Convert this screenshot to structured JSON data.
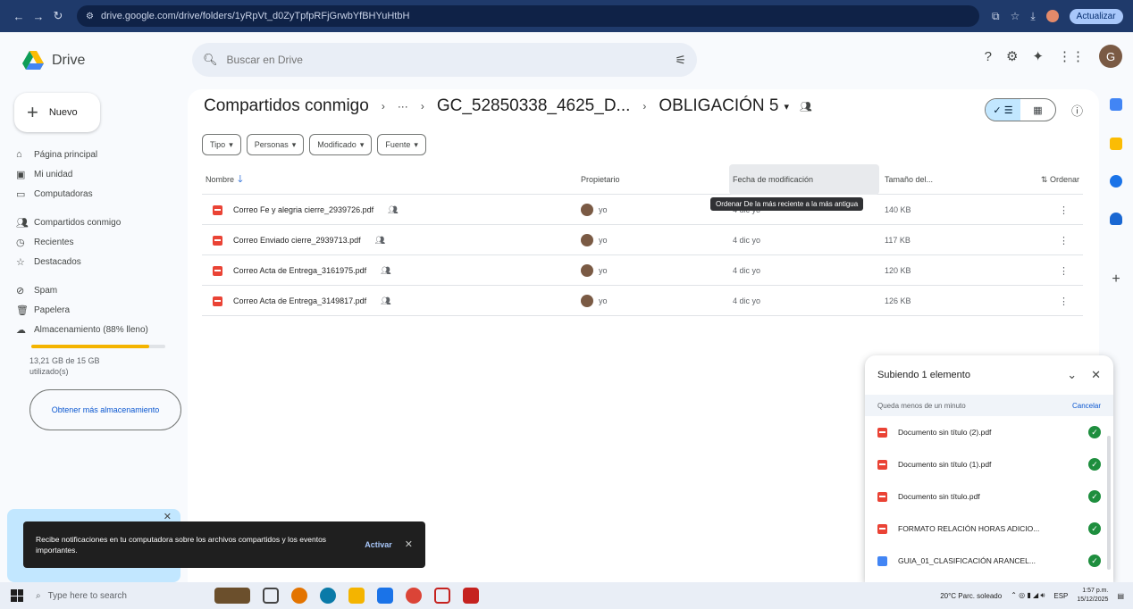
{
  "browser": {
    "url": "drive.google.com/drive/folders/1yRpVt_d0ZyTpfpRFjGrwbYfBHYuHtbH",
    "update_label": "Actualizar"
  },
  "header": {
    "app_name": "Drive",
    "search_placeholder": "Buscar en Drive",
    "avatar_letter": "G"
  },
  "sidebar": {
    "new_label": "Nuevo",
    "items": [
      {
        "label": "Página principal",
        "icon": "home-icon"
      },
      {
        "label": "Mi unidad",
        "icon": "drive-icon"
      },
      {
        "label": "Computadoras",
        "icon": "computer-icon"
      },
      {
        "label": "Compartidos conmigo",
        "icon": "shared-icon"
      },
      {
        "label": "Recientes",
        "icon": "clock-icon"
      },
      {
        "label": "Destacados",
        "icon": "star-icon"
      },
      {
        "label": "Spam",
        "icon": "spam-icon"
      },
      {
        "label": "Papelera",
        "icon": "trash-icon"
      },
      {
        "label": "Almacenamiento (88% lleno)",
        "icon": "cloud-icon"
      }
    ],
    "storage_fraction": 0.88,
    "storage_text": "13,21 GB de 15 GB utilizado(s)",
    "get_storage_label": "Obtener más almacenamiento"
  },
  "breadcrumb": {
    "root": "Compartidos conmigo",
    "more": "···",
    "middle": "GC_52850338_4625_D...",
    "current": "OBLIGACIÓN 5"
  },
  "filters": [
    "Tipo",
    "Personas",
    "Modificado",
    "Fuente"
  ],
  "table": {
    "headers": {
      "name": "Nombre",
      "owner": "Propietario",
      "modified": "Fecha de modificación",
      "size": "Tamaño del...",
      "sort": "Ordenar"
    },
    "tooltip": "Ordenar De la más reciente a la más antigua",
    "rows": [
      {
        "name": "Correo Fe y alegria cierre_2939726.pdf",
        "owner": "yo",
        "modified": "4 dic yo",
        "size": "140 KB"
      },
      {
        "name": "Correo Enviado cierre_2939713.pdf",
        "owner": "yo",
        "modified": "4 dic yo",
        "size": "117 KB"
      },
      {
        "name": "Correo Acta de Entrega_3161975.pdf",
        "owner": "yo",
        "modified": "4 dic yo",
        "size": "120 KB"
      },
      {
        "name": "Correo Acta de Entrega_3149817.pdf",
        "owner": "yo",
        "modified": "4 dic yo",
        "size": "126 KB"
      }
    ]
  },
  "upload": {
    "title": "Subiendo 1 elemento",
    "status": "Queda menos de un minuto",
    "cancel": "Cancelar",
    "items": [
      {
        "name": "Documento sin título (2).pdf",
        "type": "pdf"
      },
      {
        "name": "Documento sin título (1).pdf",
        "type": "pdf"
      },
      {
        "name": "Documento sin título.pdf",
        "type": "pdf"
      },
      {
        "name": "FORMATO RELACIÓN HORAS ADICIO...",
        "type": "pdf"
      },
      {
        "name": "GUIA_01_CLASIFICACIÓN ARANCEL...",
        "type": "doc"
      }
    ]
  },
  "notification": {
    "message": "Recibe notificaciones en tu computadora sobre los archivos compartidos y los eventos importantes.",
    "action": "Activar"
  },
  "taskbar": {
    "search_placeholder": "Type here to search",
    "weather": "20°C Parc. soleado",
    "lang": "ESP",
    "time": "1:57 p.m.",
    "date": "15/12/2025"
  },
  "colors": {
    "accent": "#0b57d0",
    "selected_view": "#c2e7ff",
    "pdf_red": "#ea4335",
    "ok_green": "#1e8e3e"
  }
}
